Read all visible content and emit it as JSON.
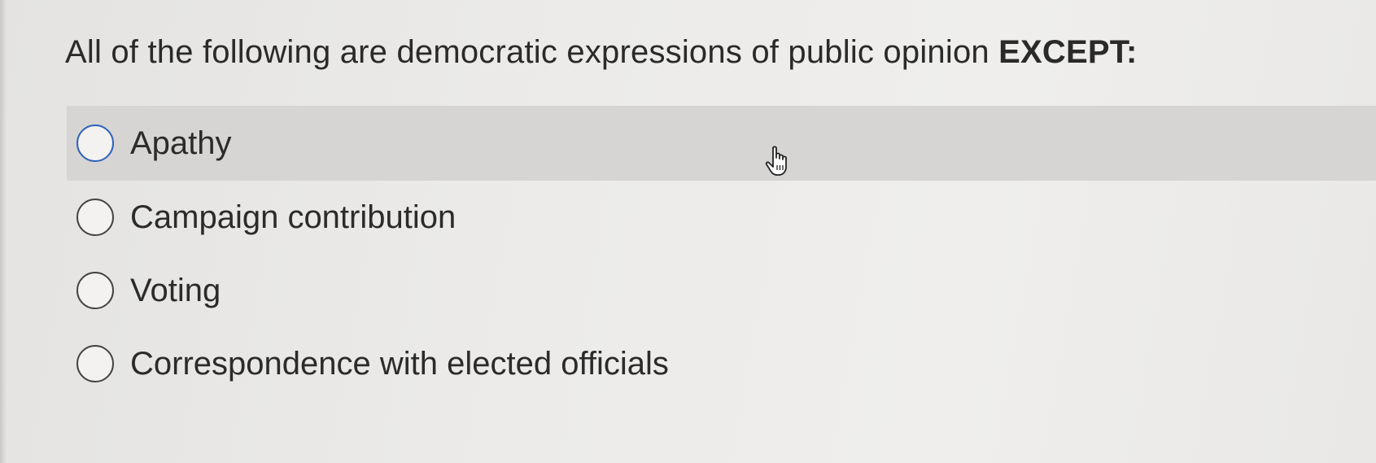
{
  "question": {
    "text_before": "All of the following are democratic expressions of public opinion ",
    "emphasis": "EXCEPT:"
  },
  "options": [
    {
      "label": "Apathy",
      "hovered": true
    },
    {
      "label": "Campaign contribution",
      "hovered": false
    },
    {
      "label": "Voting",
      "hovered": false
    },
    {
      "label": "Correspondence with elected officials",
      "hovered": false
    }
  ],
  "colors": {
    "hover_row": "#d6d5d3",
    "radio_hover_border": "#2f63b8",
    "radio_border": "#444444",
    "text": "#2b2b2b"
  },
  "icons": {
    "cursor": "hand-pointer-icon"
  }
}
